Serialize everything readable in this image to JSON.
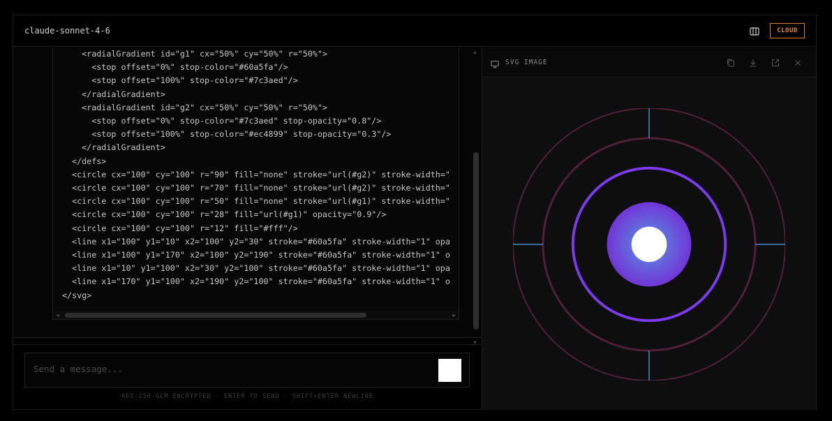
{
  "header": {
    "model_name": "claude-sonnet-4-6",
    "layout_icon": "columns-icon",
    "badge": "CLOUD",
    "badge_color": "#e08a30"
  },
  "code": {
    "lines": [
      "    <radialGradient id=\"g1\" cx=\"50%\" cy=\"50%\" r=\"50%\">",
      "      <stop offset=\"0%\" stop-color=\"#60a5fa\"/>",
      "      <stop offset=\"100%\" stop-color=\"#7c3aed\"/>",
      "    </radialGradient>",
      "    <radialGradient id=\"g2\" cx=\"50%\" cy=\"50%\" r=\"50%\">",
      "      <stop offset=\"0%\" stop-color=\"#7c3aed\" stop-opacity=\"0.8\"/>",
      "      <stop offset=\"100%\" stop-color=\"#ec4899\" stop-opacity=\"0.3\"/>",
      "    </radialGradient>",
      "  </defs>",
      "  <circle cx=\"100\" cy=\"100\" r=\"90\" fill=\"none\" stroke=\"url(#g2)\" stroke-width=\"",
      "  <circle cx=\"100\" cy=\"100\" r=\"70\" fill=\"none\" stroke=\"url(#g2)\" stroke-width=\"",
      "  <circle cx=\"100\" cy=\"100\" r=\"50\" fill=\"none\" stroke=\"url(#g1)\" stroke-width=\"",
      "  <circle cx=\"100\" cy=\"100\" r=\"28\" fill=\"url(#g1)\" opacity=\"0.9\"/>",
      "  <circle cx=\"100\" cy=\"100\" r=\"12\" fill=\"#fff\"/>",
      "  <line x1=\"100\" y1=\"10\" x2=\"100\" y2=\"30\" stroke=\"#60a5fa\" stroke-width=\"1\" opa",
      "  <line x1=\"100\" y1=\"170\" x2=\"100\" y2=\"190\" stroke=\"#60a5fa\" stroke-width=\"1\" o",
      "  <line x1=\"10\" y1=\"100\" x2=\"30\" y2=\"100\" stroke=\"#60a5fa\" stroke-width=\"1\" opa",
      "  <line x1=\"170\" y1=\"100\" x2=\"190\" y2=\"100\" stroke=\"#60a5fa\" stroke-width=\"1\" o",
      "</svg>"
    ]
  },
  "composer": {
    "placeholder": "Send a message...",
    "footer": "AES-256-GCM ENCRYPTED · ENTER TO SEND · SHIFT+ENTER NEWLINE"
  },
  "preview": {
    "title": "SVG IMAGE",
    "icons": [
      "monitor-icon",
      "copy-icon",
      "download-icon",
      "open-external-icon",
      "close-icon"
    ],
    "colors": {
      "blue": "#60a5fa",
      "violet": "#7c3aed",
      "pink": "#ec4899",
      "white": "#fff"
    }
  }
}
